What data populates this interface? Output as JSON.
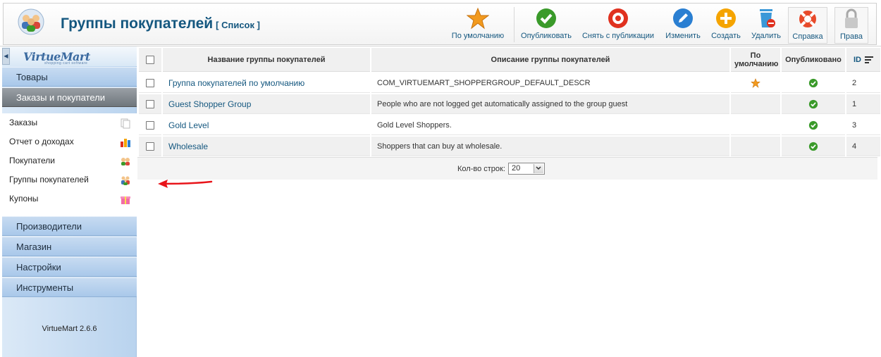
{
  "header": {
    "title": "Группы покупателей",
    "subtitle": "[ Список ]",
    "toolbar": {
      "default": "По умолчанию",
      "publish": "Опубликовать",
      "unpublish": "Снять с публикации",
      "edit": "Изменить",
      "create": "Создать",
      "delete": "Удалить",
      "help": "Справка",
      "permissions": "Права"
    }
  },
  "sidebar": {
    "logo": "VirtueMart",
    "logo_sub": "shopping cart software",
    "sections_top": [
      "Товары",
      "Заказы и покупатели"
    ],
    "submenu": [
      "Заказы",
      "Отчет о доходах",
      "Покупатели",
      "Группы покупателей",
      "Купоны"
    ],
    "sections_bottom": [
      "Производители",
      "Магазин",
      "Настройки",
      "Инструменты"
    ],
    "version": "VirtueMart 2.6.6"
  },
  "table": {
    "columns": {
      "name": "Название группы покупателей",
      "description": "Описание группы покупателей",
      "default": "По умолчанию",
      "published": "Опубликовано",
      "id": "ID"
    },
    "rows": [
      {
        "name": "Группа покупателей по умолчанию",
        "description": "COM_VIRTUEMART_SHOPPERGROUP_DEFAULT_DESCR",
        "is_default": true,
        "published": true,
        "id": "2"
      },
      {
        "name": "Guest Shopper Group",
        "description": "People who are not logged get automatically assigned to the group guest",
        "is_default": false,
        "published": true,
        "id": "1"
      },
      {
        "name": "Gold Level",
        "description": "Gold Level Shoppers.",
        "is_default": false,
        "published": true,
        "id": "3"
      },
      {
        "name": "Wholesale",
        "description": "Shoppers that can buy at wholesale.",
        "is_default": false,
        "published": true,
        "id": "4"
      }
    ]
  },
  "pager": {
    "label": "Кол-во строк:",
    "value": "20"
  },
  "colors": {
    "link": "#14577f",
    "published_green": "#3a9a2a",
    "star_orange": "#f29a1e",
    "annotation_red": "#e8141a"
  }
}
